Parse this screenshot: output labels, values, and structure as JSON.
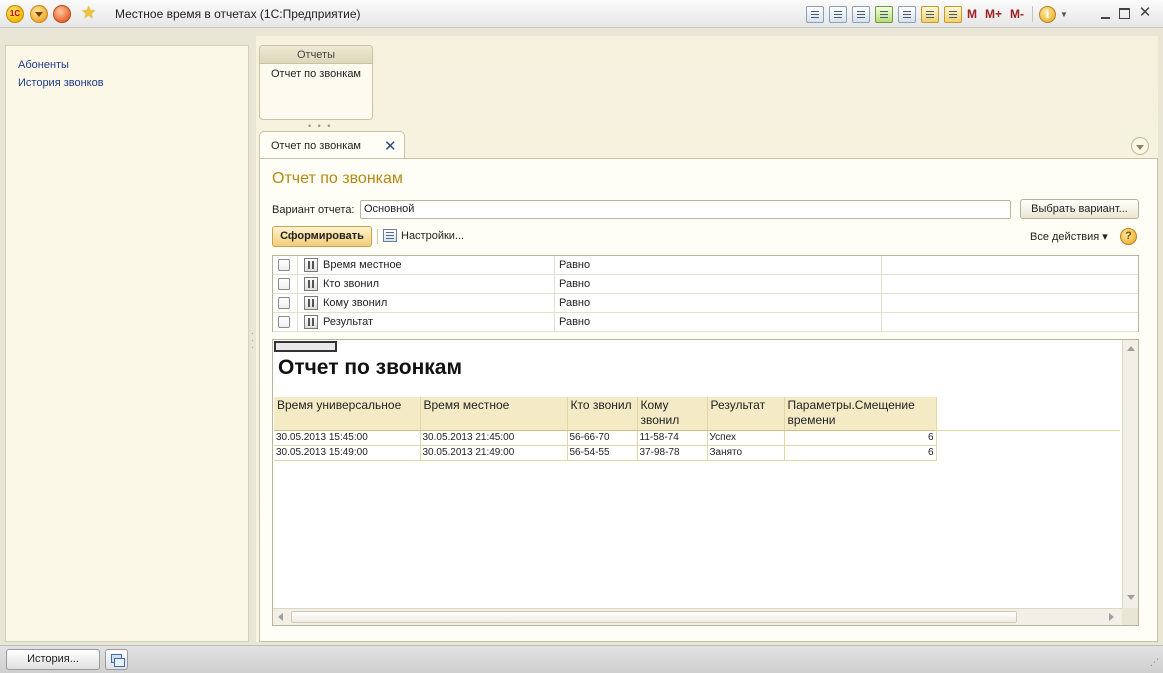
{
  "window": {
    "title": "Местное время в отчетах  (1С:Предприятие)",
    "logo_text": "1С",
    "tb_m": "M",
    "tb_mplus": "M+",
    "tb_mminus": "M-",
    "info": "i",
    "close_glyph": "✕"
  },
  "sidebar": {
    "items": [
      {
        "label": "Абоненты"
      },
      {
        "label": "История звонков"
      }
    ]
  },
  "reports_panel": {
    "header": "Отчеты",
    "item": "Отчет по звонкам"
  },
  "tab": {
    "label": "Отчет по звонкам",
    "close": "✕"
  },
  "form": {
    "title": "Отчет по звонкам",
    "variant_label": "Вариант отчета:",
    "variant_value": "Основной",
    "choose_variant": "Выбрать вариант...",
    "generate": "Сформировать",
    "settings": "Настройки...",
    "all_actions": "Все действия ▾",
    "help": "?"
  },
  "filters": [
    {
      "field": "Время местное",
      "op": "Равно"
    },
    {
      "field": "Кто звонил",
      "op": "Равно"
    },
    {
      "field": "Кому звонил",
      "op": "Равно"
    },
    {
      "field": "Результат",
      "op": "Равно"
    }
  ],
  "report": {
    "title": "Отчет по звонкам",
    "columns": {
      "c1": "Время универсальное",
      "c2": "Время местное",
      "c3": "Кто звонил",
      "c4": "Кому звонил",
      "c5": "Результат",
      "c6": "Параметры.Смещение времени"
    },
    "rows": [
      {
        "utc": "30.05.2013 15:45:00",
        "local": "30.05.2013 21:45:00",
        "from": "56-66-70",
        "to": "11-58-74",
        "result": "Успех",
        "offset": "6"
      },
      {
        "utc": "30.05.2013 15:49:00",
        "local": "30.05.2013 21:49:00",
        "from": "56-54-55",
        "to": "37-98-78",
        "result": "Занято",
        "offset": "6"
      }
    ]
  },
  "bottom": {
    "history": "История..."
  }
}
